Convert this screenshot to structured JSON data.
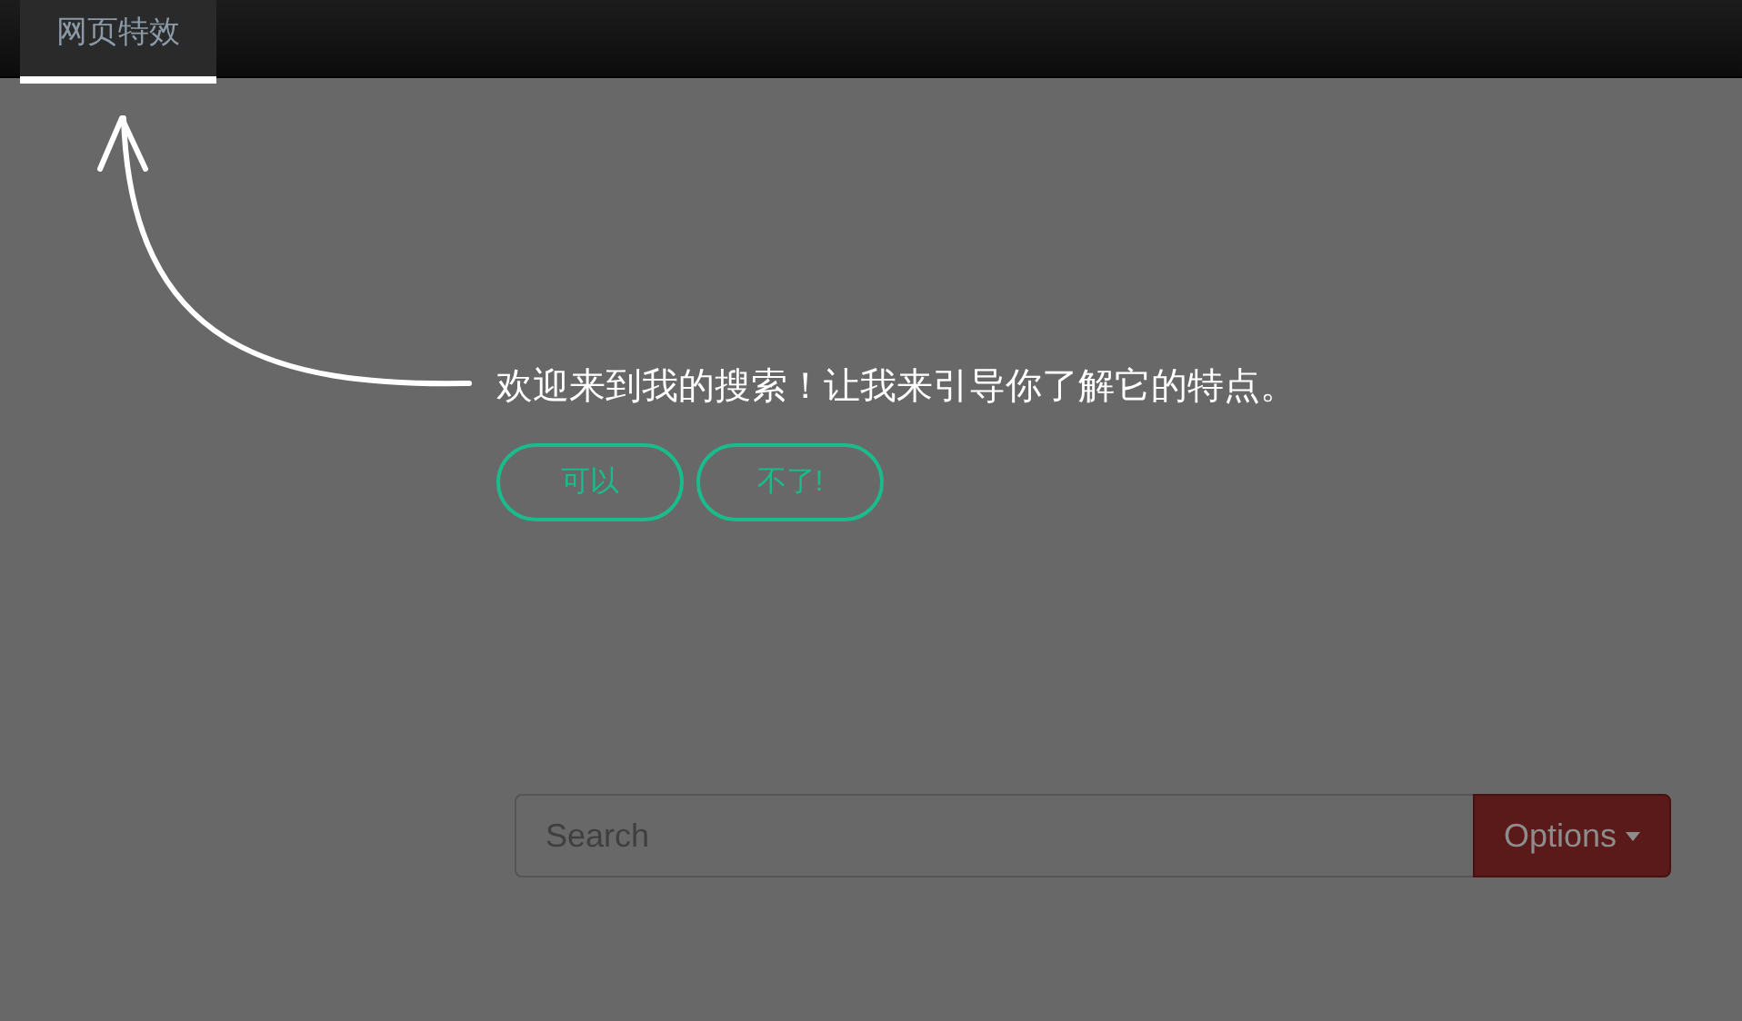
{
  "navbar": {
    "tabs": [
      {
        "label": "网页特效",
        "selected": true
      }
    ]
  },
  "tour": {
    "message": "欢迎来到我的搜索！让我来引导你了解它的特点。",
    "buttons": [
      "可以",
      "不了!"
    ]
  },
  "search": {
    "placeholder": "Search",
    "button_label": "Options"
  }
}
